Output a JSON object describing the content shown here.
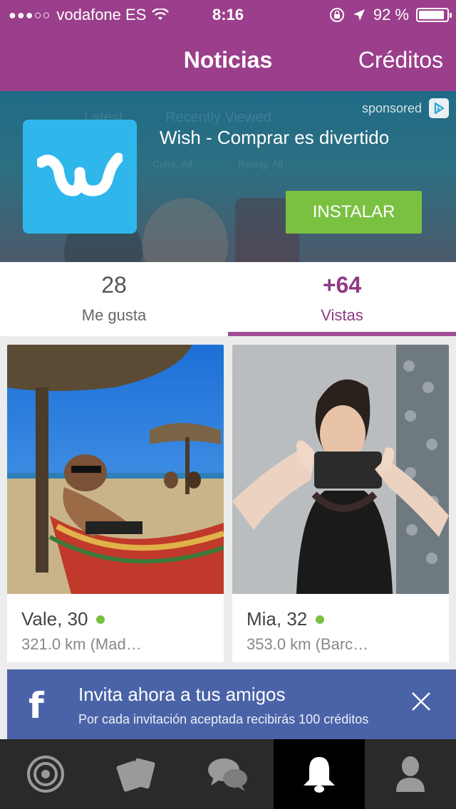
{
  "status_bar": {
    "signal_dots": "●●●○○",
    "carrier": "vodafone ES",
    "time": "8:16",
    "battery": "92 %"
  },
  "header": {
    "title": "Noticias",
    "right_action": "Créditos"
  },
  "ad": {
    "sponsored_label": "sponsored",
    "app_name": "Wish - Comprar es divertido",
    "install_label": "INSTALAR",
    "background_text": [
      "Latest",
      "Recently Viewed",
      "Color: All",
      "Rating: All"
    ]
  },
  "stats": {
    "likes": {
      "value": "28",
      "label": "Me gusta"
    },
    "views": {
      "value": "+64",
      "label": "Vistas"
    }
  },
  "cards": [
    {
      "name": "Vale, 30",
      "distance": "321.0 km (Mad…"
    },
    {
      "name": "Mia, 32",
      "distance": "353.0 km (Barc…"
    }
  ],
  "invite": {
    "title": "Invita ahora a tus amigos",
    "subtitle": "Por cada invitación aceptada recibirás 100 créditos"
  },
  "tabbar": {
    "items": [
      {
        "icon": "radar-icon"
      },
      {
        "icon": "cards-icon"
      },
      {
        "icon": "chat-icon"
      },
      {
        "icon": "bell-icon",
        "active": true
      },
      {
        "icon": "profile-icon"
      }
    ]
  },
  "colors": {
    "brand_purple": "#9b3f8c",
    "accent_green": "#7ac142",
    "facebook_blue": "#4a63a8",
    "wish_blue": "#2fb7ec"
  }
}
